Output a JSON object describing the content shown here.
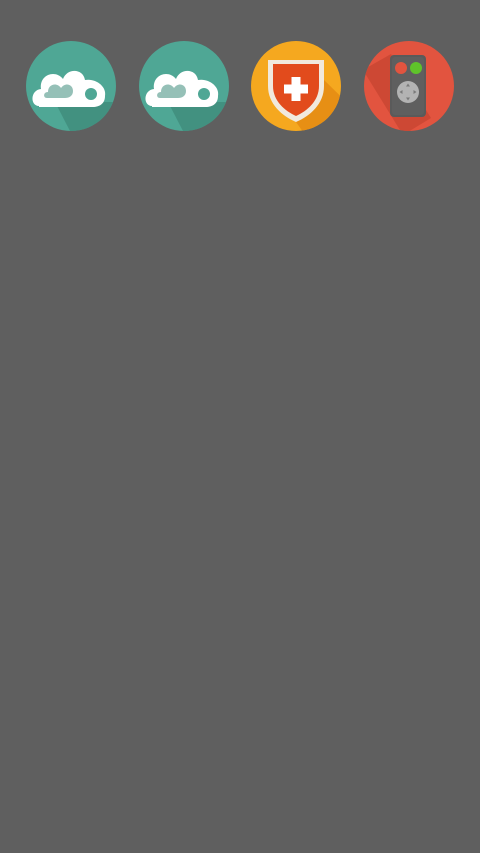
{
  "screen": {
    "background": "#5f5f5f"
  },
  "apps": [
    {
      "icon": "cloud-heart-icon",
      "color": "#4fa795"
    },
    {
      "icon": "cloud-heart-icon",
      "color": "#4fa795"
    },
    {
      "icon": "shield-plus-icon",
      "color": "#f5a81f"
    },
    {
      "icon": "remote-control-icon",
      "color": "#e2543f"
    }
  ]
}
